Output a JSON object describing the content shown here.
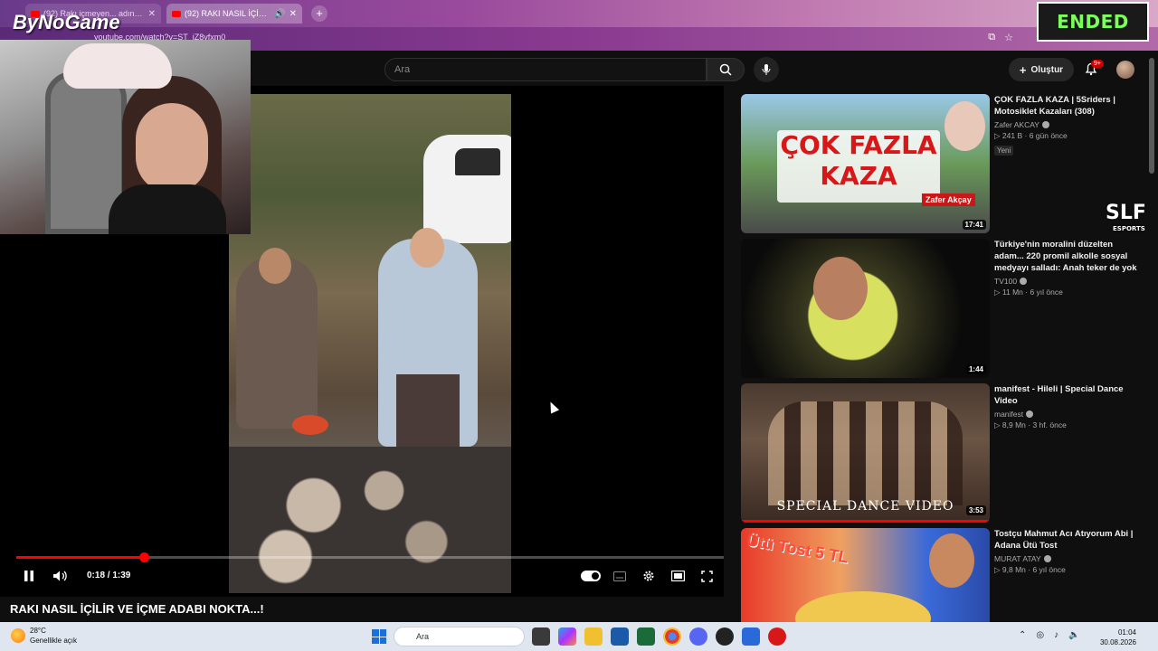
{
  "browser": {
    "tabs": [
      {
        "label": "(92) Rakı içmeyen... adına ben"
      },
      {
        "label": "(92) RAKI NASIL İÇİLİR VE İÇ"
      }
    ],
    "url": "youtube.com/watch?v=ST_iZ8yfxm0"
  },
  "overlay": {
    "ended_label": "ENDED",
    "streamer_logo": "ByNoGame",
    "sponsor_logo": "SLF",
    "sponsor_sub": "ESPORTS"
  },
  "header": {
    "search_placeholder": "Ara",
    "create_label": "Oluştur",
    "notification_count": "9+"
  },
  "player": {
    "current_time": "0:18",
    "duration": "1:39",
    "time_display": "0:18 / 1:39",
    "progress_fraction": 0.18,
    "title": "RAKI NASIL İÇİLİR VE İÇME ADABI NOKTA...!"
  },
  "recommendations": [
    {
      "title": "ÇOK FAZLA KAZA | 5Sriders | Motosiklet Kazaları (308)",
      "channel": "Zafer AKCAY",
      "views": "241 B",
      "age": "6 gün önce",
      "badge": "Yeni",
      "duration": "17:41",
      "thumb_text_1": "ÇOK FAZLA",
      "thumb_text_2": "KAZA",
      "thumb_tag": "Zafer Akçay"
    },
    {
      "title": "Türkiye'nin moralini düzelten adam... 220 promil alkolle sosyal medyayı salladı: Anah teker de yok",
      "channel": "TV100",
      "views": "11 Mn",
      "age": "6 yıl önce",
      "duration": "1:44"
    },
    {
      "title": "manifest - Hileli | Special Dance Video",
      "channel": "manifest",
      "views": "8,9 Mn",
      "age": "3 hf. önce",
      "duration": "3:53",
      "thumb_caption": "SPECIAL DANCE VIDEO"
    },
    {
      "title": "Tostçu Mahmut Acı Atıyorum Abi | Adana Ütü Tost",
      "channel": "MURAT ATAY",
      "views": "9,8 Mn",
      "age": "6 yıl önce",
      "thumb_text": "Ütü Tost 5 TL"
    }
  ],
  "taskbar": {
    "temperature": "28°C",
    "weather": "Genellikle açık",
    "search_placeholder": "Ara",
    "time": "01:04",
    "date": "30.08.2026"
  }
}
